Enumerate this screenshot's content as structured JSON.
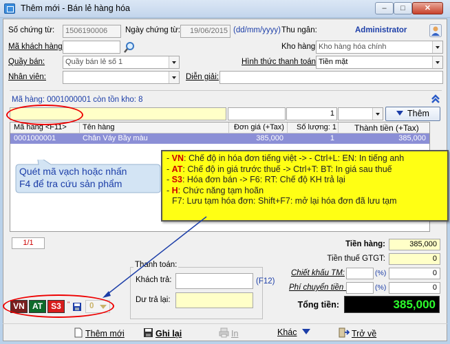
{
  "window": {
    "title": "Thêm mới - Bán lẻ hàng hóa",
    "min": "–",
    "max": "□",
    "close": "✕"
  },
  "form": {
    "so_chung_tu_label": "Số chứng từ:",
    "so_chung_tu_value": "1506190006",
    "ngay_chung_tu_label": "Ngày chứng từ:",
    "ngay_chung_tu_value": "19/06/2015",
    "date_format": "(dd/mm/yyyy)",
    "thu_ngan_label": "Thu ngân:",
    "thu_ngan_value": "Administrator",
    "ma_khach_hang_label": "Mã khách hàng:",
    "ma_khach_hang_value": "",
    "kho_hang_label": "Kho hàng:",
    "kho_hang_value": "Kho hàng hóa chính",
    "quay_ban_label": "Quầy bán:",
    "quay_ban_value": "Quầy bán lẻ số 1",
    "hinh_thuc_tt_label": "Hình thức thanh toán:",
    "hinh_thuc_tt_value": "Tiền mặt",
    "nhan_vien_label": "Nhân viên:",
    "nhan_vien_value": "",
    "dien_giai_label": "Diễn giải:",
    "dien_giai_value": ""
  },
  "item_entry": {
    "stock_info": "Mã hàng: 0001000001 còn tồn kho: 8",
    "quantity": "1",
    "add_label": "Thêm"
  },
  "grid": {
    "headers": [
      "Mã hàng <F11>",
      "Tên hàng",
      "Đơn giá (+Tax)",
      "Số lượng: 1",
      "Thành tiền (+Tax)"
    ],
    "row": {
      "ma_hang": "0001000001",
      "ten_hang": "Chân Váy Bầy màu",
      "don_gia": "385,000",
      "so_luong": "1",
      "thanh_tien": "385,000"
    }
  },
  "callouts": {
    "left_line1": "Quét mã vạch hoặc nhấn",
    "left_line2": "F4 để tra cứu sản phẩm",
    "right_lines": [
      {
        "key": "VN",
        "text": ": Chế độ in hóa đơn tiếng việt -> - Ctrl+L: EN: In tiếng anh"
      },
      {
        "key": "AT",
        "text": ": Chế độ in giá trước thuế -> Ctrl+T: BT: In giá sau thuế"
      },
      {
        "key": "S3",
        "text": ": Hóa đơn bán -> F6: RT: Chế độ KH trả lại"
      },
      {
        "key": "H",
        "text": ": Chức năng tạm hoãn"
      },
      {
        "key": "",
        "text": "F7: Lưu tạm hóa đơn: Shift+F7: mở lại hóa đơn đã lưu tạm"
      }
    ]
  },
  "pager": "1/1",
  "payment": {
    "group_label": "Thanh toán:",
    "khach_tra_label": "Khách trả:",
    "khach_tra_value": "",
    "f12_hint": "(F12)",
    "du_tra_lai_label": "Dư trả lại:",
    "du_tra_lai_value": ""
  },
  "totals": {
    "tien_hang_label": "Tiền hàng:",
    "tien_hang_value": "385,000",
    "tien_thue_label": "Tiền thuế GTGT:",
    "tien_thue_value": "0",
    "chiet_khau_label": "Chiết khấu TM:",
    "chiet_khau_pct": "",
    "chiet_khau_value": "0",
    "phi_chuyen_label": "Phí chuyển tiền :",
    "phi_chuyen_pct": "",
    "phi_chuyen_value": "0",
    "tong_tien_label": "Tổng tiền:",
    "tong_tien_value": "385,000",
    "pct": "(%)"
  },
  "mode_buttons": {
    "vn": "VN",
    "at": "AT",
    "s3": "S3",
    "hold_count": "0"
  },
  "toolbar": {
    "them_moi": "Thêm mới",
    "ghi_lai": "Ghi lại",
    "in": "In",
    "khac": "Khác",
    "tro_ve": "Trở về"
  },
  "colors": {
    "accent_blue": "#1c3ea8",
    "callout_yellow": "#ffff14",
    "total_green": "#2cff2c",
    "vn_btn": "#7a1e1e",
    "at_btn": "#0e6a2a",
    "s3_btn": "#d81c1c"
  }
}
